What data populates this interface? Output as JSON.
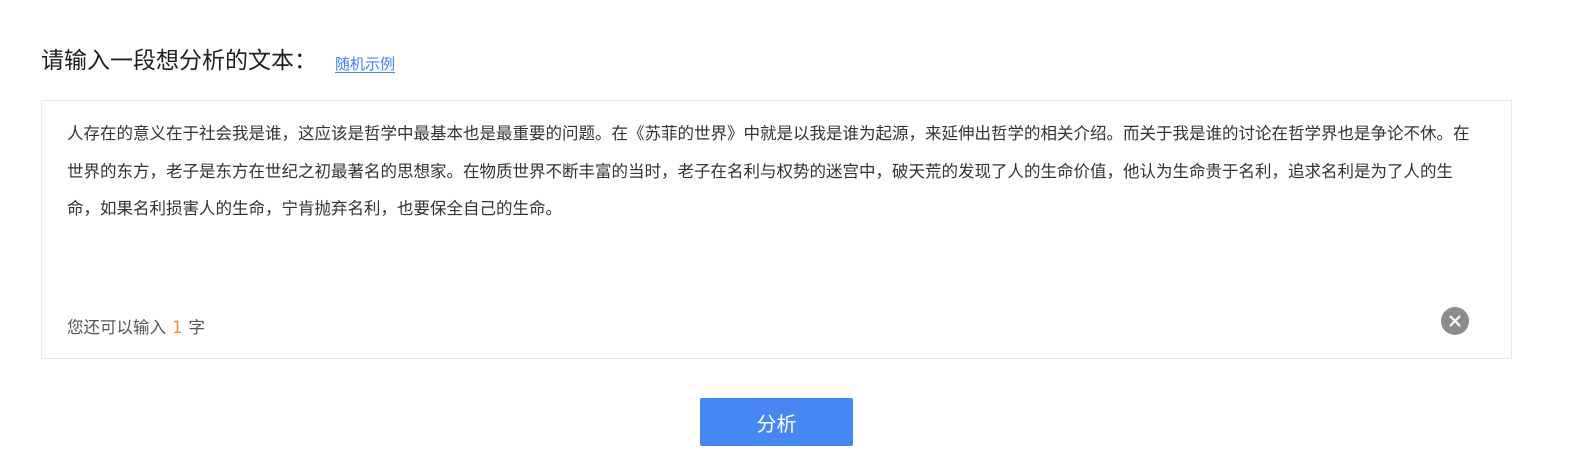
{
  "header": {
    "title": "请输入一段想分析的文本：",
    "sample_link": "随机示例"
  },
  "input": {
    "text": "人存在的意义在于社会我是谁，这应该是哲学中最基本也是最重要的问题。在《苏菲的世界》中就是以我是谁为起源，来延伸出哲学的相关介绍。而关于我是谁的讨论在哲学界也是争论不休。在世界的东方，老子是东方在世纪之初最著名的思想家。在物质世界不断丰富的当时，老子在名利与权势的迷宫中，破天荒的发现了人的生命价值，他认为生命贵于名利，追求名利是为了人的生命，如果名利损害人的生命，宁肯抛弃名利，也要保全自己的生命。",
    "counter_prefix": "您还可以输入",
    "counter_value": "1",
    "counter_suffix": "字",
    "clear_icon": "close-circle-icon"
  },
  "actions": {
    "analyze_label": "分析"
  },
  "colors": {
    "accent": "#4687f4",
    "link": "#3b82f6",
    "counter_highlight": "#f58a3a"
  }
}
